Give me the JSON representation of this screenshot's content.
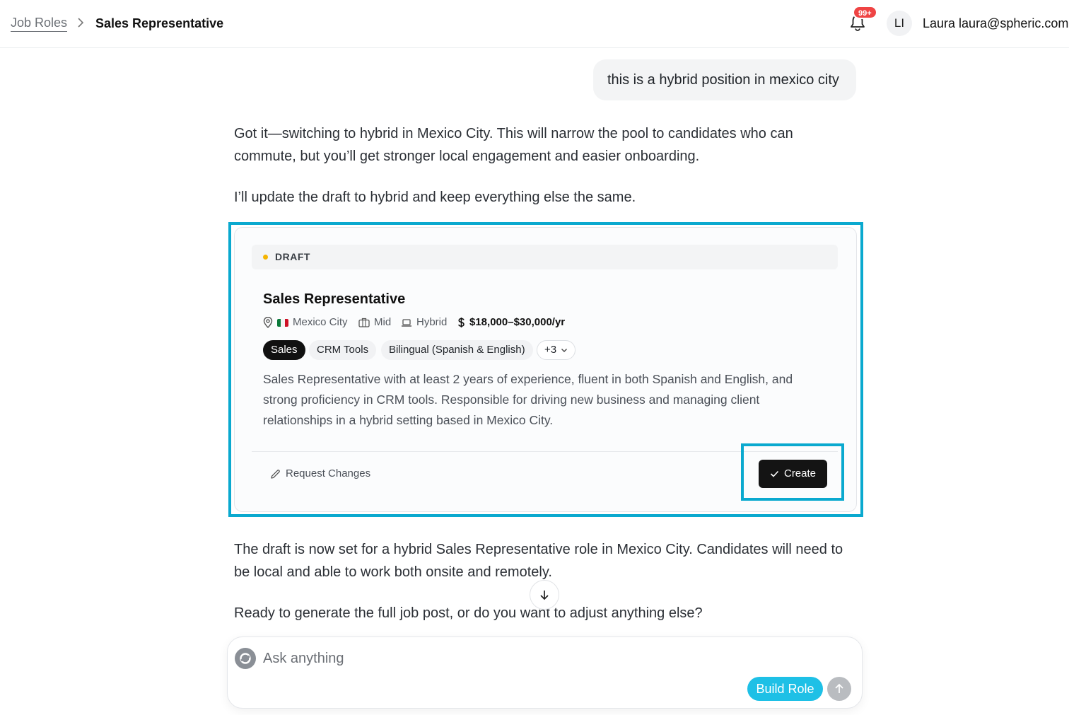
{
  "header": {
    "breadcrumb_root": "Job Roles",
    "breadcrumb_current": "Sales Representative",
    "notifications_badge": "99+",
    "avatar_initials": "LI",
    "user_name": "Laura",
    "user_email": "laura@spheric.com"
  },
  "chat": {
    "user_message": "this is a hybrid position in mexico city",
    "assistant_para_1": "Got it—switching to hybrid in Mexico City. This will narrow the pool to candidates who can commute, but you’ll get stronger local engagement and easier onboarding.",
    "assistant_para_2": "I’ll update the draft to hybrid and keep everything else the same.",
    "assistant_para_3": "The draft is now set for a hybrid Sales Representative role in Mexico City. Candidates will need to be local and able to work both onsite and remotely.",
    "assistant_para_4": "Ready to generate the full job post, or do you want to adjust anything else?"
  },
  "draft_card": {
    "status": "DRAFT",
    "status_color": "#f5b400",
    "title": "Sales Representative",
    "location": "Mexico City",
    "level": "Mid",
    "work_mode": "Hybrid",
    "salary": "$18,000–$30,000/yr",
    "tags": [
      "Sales",
      "CRM Tools",
      "Bilingual (Spanish & English)"
    ],
    "more_tags": "+3",
    "description": "Sales Representative with at least 2 years of experience, fluent in both Spanish and English, and strong proficiency in CRM tools. Responsible for driving new business and managing client relationships in a hybrid setting based in Mexico City.",
    "request_changes_label": "Request Changes",
    "create_label": "Create"
  },
  "composer": {
    "placeholder": "Ask anything",
    "build_role_label": "Build Role"
  },
  "colors": {
    "highlight": "#0aa9cf",
    "accent": "#1ec0e6"
  }
}
